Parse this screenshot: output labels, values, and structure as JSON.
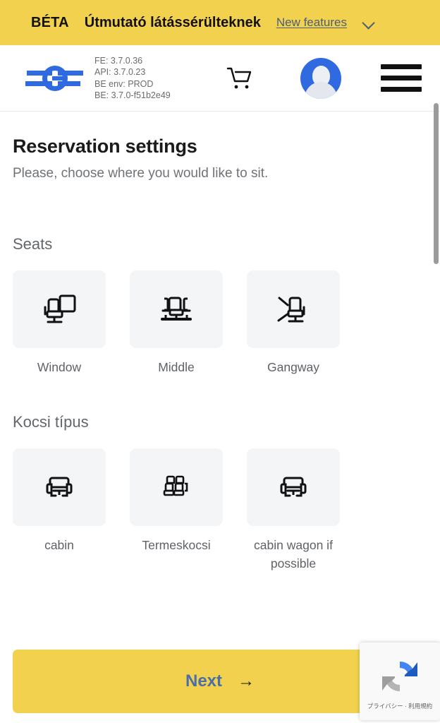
{
  "banner": {
    "beta_tag": "BÉTA",
    "guide_label": "Útmutató látássérülteknek",
    "new_features_label": "New features",
    "chevron_icon": "chevron-down-icon",
    "background_color": "#f2d14e"
  },
  "header": {
    "logo_icon": "mav-logo-icon",
    "versions": {
      "fe": "FE: 3.7.0.36",
      "api": "API: 3.7.0.23",
      "be_env": "BE env: PROD",
      "be": "BE: 3.7.0-f51b2e49"
    },
    "cart_icon": "shopping-cart-icon",
    "avatar_icon": "user-avatar-icon",
    "menu_icon": "hamburger-menu-icon",
    "accent_color": "#2f6ae1"
  },
  "main": {
    "title": "Reservation settings",
    "subtitle": "Please, choose where you would like to sit.",
    "seats": {
      "section_title": "Seats",
      "options": [
        {
          "label": "Window",
          "icon": "seat-window-icon"
        },
        {
          "label": "Middle",
          "icon": "seat-middle-icon"
        },
        {
          "label": "Gangway",
          "icon": "seat-gangway-icon"
        }
      ]
    },
    "wagon": {
      "section_title": "Kocsi típus",
      "options": [
        {
          "label": "cabin",
          "icon": "cabin-compartment-icon"
        },
        {
          "label": "Termeskocsi",
          "icon": "open-saloon-seats-icon"
        },
        {
          "label": "cabin wagon if possible",
          "icon": "cabin-compartment-icon"
        }
      ]
    }
  },
  "footer": {
    "next_label": "Next",
    "next_arrow_icon": "arrow-right-icon",
    "next_background_color": "#f2d14e",
    "next_text_color": "#4b6ea8"
  },
  "recaptcha": {
    "logo_icon": "recaptcha-logo-icon",
    "text": "プライバシー · 利用規約"
  }
}
